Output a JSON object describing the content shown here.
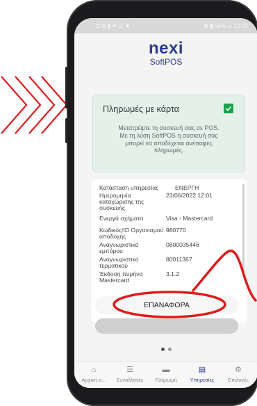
{
  "statusbar": {
    "left_icons": "⊡ ⊠ ▮ ✉ ☰ ▼",
    "right_text": "⊠ ▮ 56% ▭ 12:00"
  },
  "brand": {
    "name": "nexi",
    "product": "SoftPOS"
  },
  "card": {
    "title": "Πληρωμές με κάρτα",
    "description_lines": [
      "Μετατρέψτε τη συσκευή σας σε POS.",
      "Με τη λύση SoftPOS η συσκευή σας",
      "μπορεί να αποδέχεται ανέπαφες",
      "πληρωμές."
    ]
  },
  "info": {
    "rows": [
      {
        "label": "Κατάσταση υπηρεσίας",
        "value": "ΕΝΕΡΓΗ"
      },
      {
        "label": "Ημερομηνία καταχώρισης της συσκευής",
        "value": "23/06/2022 12:01"
      },
      {
        "label": "Ενεργά σχήματα",
        "value": "Visa - Mastercard"
      },
      {
        "label": "Κωδικός/ID Οργανισμού αποδοχής",
        "value": "980770"
      },
      {
        "label": "Αναγνωριστικό εμπόρου",
        "value": "0800035446"
      },
      {
        "label": "Αναγνωριστικό τερματικού",
        "value": "80011367"
      },
      {
        "label": "Έκδοση πυρήνα Mastercard",
        "value": "3.1.2"
      }
    ]
  },
  "buttons": {
    "reset": "ΕΠΑΝΑΦΟΡΑ"
  },
  "nav": {
    "items": [
      {
        "label": "Αρχική σ...",
        "icon": "⌂"
      },
      {
        "label": "Συναλλαγές",
        "icon": "☰"
      },
      {
        "label": "Πληρωμή",
        "icon": "▬"
      },
      {
        "label": "Υπηρεσίες",
        "icon": "▤"
      },
      {
        "label": "Επιλογές",
        "icon": "⚙"
      }
    ]
  },
  "system_nav": {
    "back": "◁",
    "home": "○",
    "recents": "□"
  },
  "colors": {
    "brand": "#2d3b8f",
    "accent_green": "#1aa14b",
    "annotation_red": "#e01a1a"
  }
}
